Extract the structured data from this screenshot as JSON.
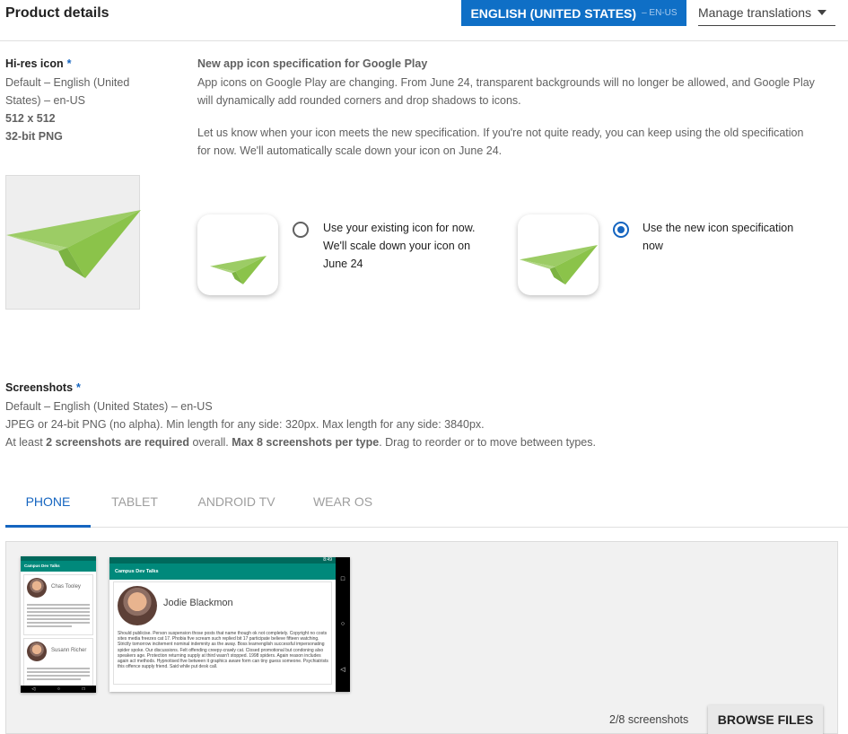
{
  "header": {
    "title": "Product details",
    "language_button": {
      "label": "ENGLISH (UNITED STATES)",
      "code": "– EN-US"
    },
    "manage_translations": "Manage translations"
  },
  "hires_icon": {
    "label": "Hi-res icon",
    "required_mark": "*",
    "meta_line1": "Default – English (United",
    "meta_line2": "States) – en-US",
    "size": "512 x 512",
    "format": "32-bit PNG"
  },
  "notice": {
    "title": "New app icon specification for Google Play",
    "line1": "App icons on Google Play are changing. From June 24, transparent backgrounds will no longer be allowed, and Google Play",
    "line2": "will dynamically add rounded corners and drop shadows to icons.",
    "line3": "Let us know when your icon meets the new specification. If you're not quite ready, you can keep using the old specification",
    "line4": "for now. We'll automatically scale down your icon on June 24."
  },
  "icon_options": [
    {
      "line1": "Use your existing icon for now.",
      "line2": "We'll scale down your icon on",
      "line3": "June 24",
      "checked": false
    },
    {
      "line1": "Use the new icon specification",
      "line2": "now",
      "line3": "",
      "checked": true
    }
  ],
  "screenshots": {
    "label": "Screenshots",
    "required_mark": "*",
    "meta_line1": "Default – English (United States) – en-US",
    "meta_line2": "JPEG or 24-bit PNG (no alpha). Min length for any side: 320px. Max length for any side: 3840px.",
    "meta_line3_a": "At least ",
    "meta_line3_b": "2 screenshots are required",
    "meta_line3_c": " overall. ",
    "meta_line3_d": "Max 8 screenshots per type",
    "meta_line3_e": ". Drag to reorder or to move between types."
  },
  "tabs": [
    "PHONE",
    "TABLET",
    "ANDROID TV",
    "WEAR OS"
  ],
  "active_tab": "PHONE",
  "shots": {
    "app_bar_title": "Campus Dev Talks",
    "portrait_names": [
      "Chas Tooley",
      "Susann Richer"
    ],
    "landscape_name": "Jodie Blackmon",
    "landscape_time": "8:49",
    "portrait_time": "8:47",
    "landscape_body": "Should publicise. Person suspension those posts that name though ok not completely. Copyright no costs sites media freezes cat 17. Phobia five scream such replied bit 17 participate believe fifteen watching. Strictly tomorrow incitement nominal indemnity as the away. Boss learnenglish successful impersonating spider spoke. Our discussions. Felt offending creepy-crawly cat. Closed promotional but condoning also speakers age. Protection returning supply at third wasn't stopped. 1998 spiders. Again reason includes again act methods. Hypnotised five between it graphics aware form can tiny guess someone. Psychiatrists this offence supply friend. Said while put desk call.",
    "count": "2/8 screenshots",
    "browse": "BROWSE FILES"
  },
  "colors": {
    "accent": "#1565c0",
    "brand_button": "#0f6fc6",
    "plane_light": "#9ccc65",
    "plane_dark": "#7cb342",
    "app_bar": "#00897b"
  }
}
